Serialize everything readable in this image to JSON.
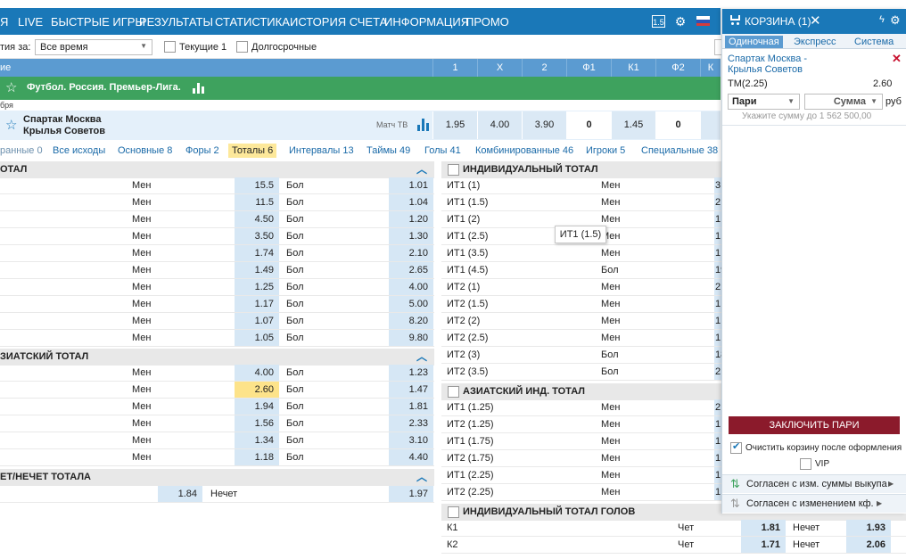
{
  "nav": {
    "items": [
      "Я",
      "LIVE",
      "БЫСТРЫЕ ИГРЫ",
      "РЕЗУЛЬТАТЫ",
      "СТАТИСТИКА",
      "ИСТОРИЯ СЧЕТА",
      "ИНФОРМАЦИЯ",
      "ПРОМО"
    ],
    "version_badge": "1.5"
  },
  "filters": {
    "period_label": "тия за:",
    "period_value": "Все время",
    "current_label": "Текущие 1",
    "longterm_label": "Долгосрочные"
  },
  "columns": {
    "event": "ие",
    "headers": [
      "1",
      "X",
      "2",
      "Ф1",
      "К1",
      "Ф2",
      "К"
    ]
  },
  "league": "Футбол. Россия. Премьер-Лига.",
  "date": "бря",
  "match": {
    "team1": "Спартак Москва",
    "team2": "Крылья Советов",
    "tv": "Матч ТВ",
    "odds": [
      "1.95",
      "4.00",
      "3.90",
      "0",
      "1.45",
      "0"
    ]
  },
  "tabs": [
    "ранные 0",
    "Все исходы",
    "Основные 8",
    "Форы 2",
    "Тоталы 6",
    "Интервалы 13",
    "Таймы 49",
    "Голы 41",
    "Комбинированные 46",
    "Игроки 5",
    "Специальные 38"
  ],
  "left": {
    "total": {
      "title": "ОТАЛ",
      "rows": [
        {
          "u": "Мен",
          "uo": "15.5",
          "o": "Бол",
          "oo": "1.01"
        },
        {
          "u": "Мен",
          "uo": "11.5",
          "o": "Бол",
          "oo": "1.04"
        },
        {
          "u": "Мен",
          "uo": "4.50",
          "o": "Бол",
          "oo": "1.20"
        },
        {
          "u": "Мен",
          "uo": "3.50",
          "o": "Бол",
          "oo": "1.30"
        },
        {
          "u": "Мен",
          "uo": "1.74",
          "o": "Бол",
          "oo": "2.10"
        },
        {
          "u": "Мен",
          "uo": "1.49",
          "o": "Бол",
          "oo": "2.65"
        },
        {
          "u": "Мен",
          "uo": "1.25",
          "o": "Бол",
          "oo": "4.00"
        },
        {
          "u": "Мен",
          "uo": "1.17",
          "o": "Бол",
          "oo": "5.00"
        },
        {
          "u": "Мен",
          "uo": "1.07",
          "o": "Бол",
          "oo": "8.20"
        },
        {
          "u": "Мен",
          "uo": "1.05",
          "o": "Бол",
          "oo": "9.80"
        }
      ]
    },
    "asian": {
      "title": "ЗИАТСКИЙ ТОТАЛ",
      "rows": [
        {
          "u": "Мен",
          "uo": "4.00",
          "o": "Бол",
          "oo": "1.23"
        },
        {
          "u": "Мен",
          "uo": "2.60",
          "o": "Бол",
          "oo": "1.47"
        },
        {
          "u": "Мен",
          "uo": "1.94",
          "o": "Бол",
          "oo": "1.81"
        },
        {
          "u": "Мен",
          "uo": "1.56",
          "o": "Бол",
          "oo": "2.33"
        },
        {
          "u": "Мен",
          "uo": "1.34",
          "o": "Бол",
          "oo": "3.10"
        },
        {
          "u": "Мен",
          "uo": "1.18",
          "o": "Бол",
          "oo": "4.40"
        }
      ]
    },
    "evenodd": {
      "title": "ЕТ/НЕЧЕТ ТОТАЛА",
      "even_odd": "1.84",
      "odd_label": "Нечет",
      "odd_odd": "1.97"
    }
  },
  "right": {
    "indiv": {
      "title": "ИНДИВИДУАЛЬНЫЙ ТОТАЛ",
      "rows": [
        {
          "n": "ИТ1 (1)",
          "t": "Мен",
          "v": "3."
        },
        {
          "n": "ИТ1 (1.5)",
          "t": "Мен",
          "v": "2."
        },
        {
          "n": "ИТ1 (2)",
          "t": "Мен",
          "v": "1."
        },
        {
          "n": "ИТ1 (2.5)",
          "t": "Мен",
          "v": "1."
        },
        {
          "n": "ИТ1 (3.5)",
          "t": "Мен",
          "v": "1."
        },
        {
          "n": "ИТ1 (4.5)",
          "t": "Бол",
          "v": "19"
        },
        {
          "n": "ИТ2 (1)",
          "t": "Мен",
          "v": "2."
        },
        {
          "n": "ИТ2 (1.5)",
          "t": "Мен",
          "v": "1."
        },
        {
          "n": "ИТ2 (2)",
          "t": "Мен",
          "v": "1."
        },
        {
          "n": "ИТ2 (2.5)",
          "t": "Мен",
          "v": "1."
        },
        {
          "n": "ИТ2 (3)",
          "t": "Бол",
          "v": "18"
        },
        {
          "n": "ИТ2 (3.5)",
          "t": "Бол",
          "v": "2."
        }
      ]
    },
    "asian_indiv": {
      "title": "АЗИАТСКИЙ ИНД. ТОТАЛ",
      "rows": [
        {
          "n": "ИТ1 (1.25)",
          "t": "Мен",
          "v": "2."
        },
        {
          "n": "ИТ2 (1.25)",
          "t": "Мен",
          "v": "1."
        },
        {
          "n": "ИТ1 (1.75)",
          "t": "Мен",
          "v": "1."
        },
        {
          "n": "ИТ2 (1.75)",
          "t": "Мен",
          "v": "1."
        },
        {
          "n": "ИТ1 (2.25)",
          "t": "Мен",
          "v": "1."
        },
        {
          "n": "ИТ2 (2.25)",
          "t": "Мен",
          "v": "1."
        }
      ]
    },
    "goals": {
      "title": "ИНДИВИДУАЛЬНЫЙ ТОТАЛ ГОЛОВ",
      "rows": [
        {
          "n": "К1",
          "e": "Чет",
          "ev": "1.81",
          "o": "Нечет",
          "ov": "1.93"
        },
        {
          "n": "К2",
          "e": "Чет",
          "ev": "1.71",
          "o": "Нечет",
          "ov": "2.06"
        }
      ]
    }
  },
  "tooltip": "ИТ1 (1.5)",
  "basket": {
    "title": "КОРЗИНА (1)",
    "tabs": [
      "Одиночная",
      "Экспресс",
      "Система"
    ],
    "event": "Спартак Москва -",
    "event2": "Крылья Советов",
    "bet": "ТМ(2.25)",
    "coef": "2.60",
    "type": "Пари",
    "sum_placeholder": "Сумма",
    "currency": "руб",
    "hint": "Укажите сумму до 1 562 500,00",
    "submit": "ЗАКЛЮЧИТЬ ПАРИ",
    "clear_label": "Очистить корзину после оформления",
    "vip_label": "VIP",
    "agree1": "Согласен с изм. суммы выкупа",
    "agree2": "Согласен с изменением кф."
  },
  "colors": {
    "nav": "#1a78b8",
    "league": "#3ea25e",
    "highlight": "#fde38a",
    "submit": "#8b1a2b"
  }
}
